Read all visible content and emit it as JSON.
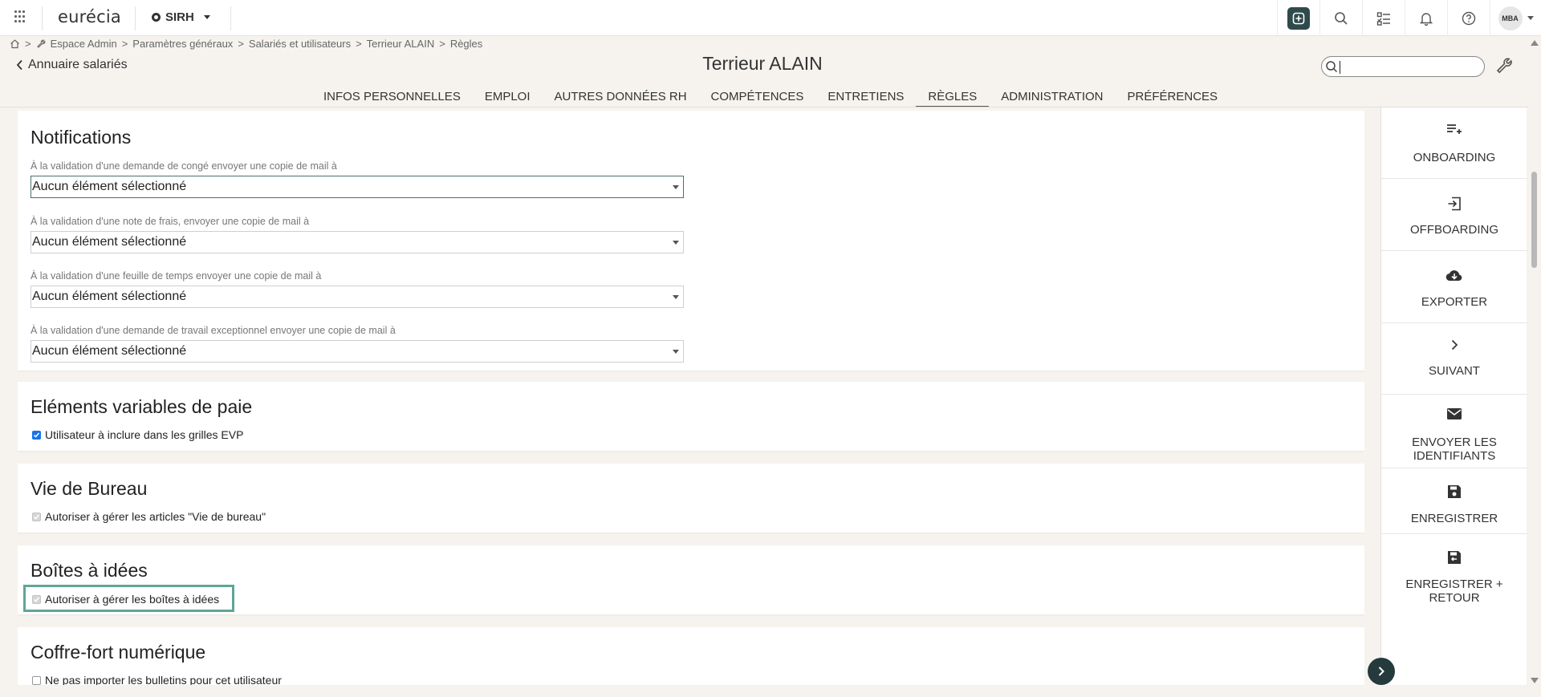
{
  "topbar": {
    "logo": "eurécia",
    "app_name": "SIRH",
    "avatar_initials": "MBA",
    "icons": [
      "apps-grid-icon",
      "add-icon",
      "search-icon",
      "tasks-icon",
      "bell-icon",
      "help-icon"
    ]
  },
  "breadcrumb": {
    "items": [
      "Espace Admin",
      "Paramètres généraux",
      "Salariés et utilisateurs",
      "Terrieur ALAIN",
      "Règles"
    ],
    "separator": ">"
  },
  "header": {
    "back_label": "Annuaire salariés",
    "title": "Terrieur ALAIN",
    "search_value": ""
  },
  "tabs": [
    {
      "label": "INFOS PERSONNELLES",
      "active": false
    },
    {
      "label": "EMPLOI",
      "active": false
    },
    {
      "label": "AUTRES DONNÉES RH",
      "active": false
    },
    {
      "label": "COMPÉTENCES",
      "active": false
    },
    {
      "label": "ENTRETIENS",
      "active": false
    },
    {
      "label": "RÈGLES",
      "active": true
    },
    {
      "label": "ADMINISTRATION",
      "active": false
    },
    {
      "label": "PRÉFÉRENCES",
      "active": false
    }
  ],
  "notifications": {
    "title": "Notifications",
    "fields": [
      {
        "label": "À la validation d'une demande de congé envoyer une copie de mail à",
        "value": "Aucun élément sélectionné"
      },
      {
        "label": "À la validation d'une note de frais, envoyer une copie de mail à",
        "value": "Aucun élément sélectionné"
      },
      {
        "label": "À la validation d'une feuille de temps envoyer une copie de mail à",
        "value": "Aucun élément sélectionné"
      },
      {
        "label": "À la validation d'une demande de travail exceptionnel envoyer une copie de mail à",
        "value": "Aucun élément sélectionné"
      }
    ]
  },
  "evp": {
    "title": "Eléments variables de paie",
    "checkbox_label": "Utilisateur à inclure dans les grilles EVP",
    "checked": true
  },
  "vie_bureau": {
    "title": "Vie de Bureau",
    "checkbox_label": "Autoriser à gérer les articles \"Vie de bureau\"",
    "checked": true,
    "disabled": true
  },
  "boites_idees": {
    "title": "Boîtes à idées",
    "checkbox_label": "Autoriser à gérer les boîtes à idées",
    "checked": true,
    "disabled": true
  },
  "coffre_fort": {
    "title": "Coffre-fort numérique",
    "checkbox_label": "Ne pas importer les bulletins pour cet utilisateur",
    "checked": false
  },
  "sidebar": {
    "items": [
      {
        "label": "ONBOARDING",
        "icon": "playlist-add-icon"
      },
      {
        "label": "OFFBOARDING",
        "icon": "exit-icon"
      },
      {
        "label": "EXPORTER",
        "icon": "cloud-download-icon"
      },
      {
        "label": "SUIVANT",
        "icon": "chevron-right-icon"
      },
      {
        "label": "ENVOYER LES IDENTIFIANTS",
        "icon": "mail-icon"
      },
      {
        "label": "ENREGISTRER",
        "icon": "save-icon"
      },
      {
        "label": "ENREGISTRER + RETOUR",
        "icon": "save-return-icon"
      }
    ]
  },
  "colors": {
    "accent": "#2f4a4c",
    "highlight": "#5fa596",
    "background": "#f6f3ee"
  }
}
